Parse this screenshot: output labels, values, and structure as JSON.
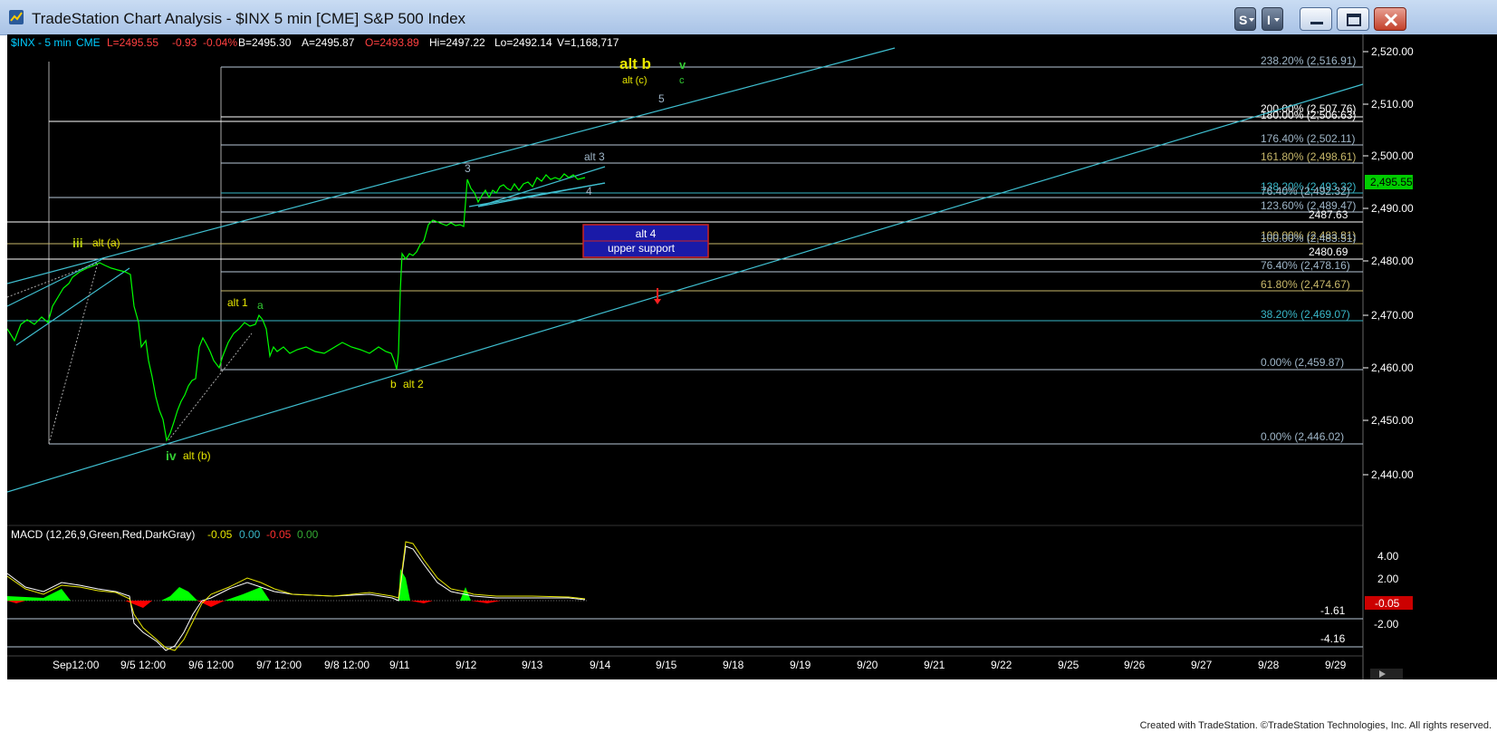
{
  "window": {
    "title": "TradeStation Chart Analysis - $INX 5 min [CME] S&P 500 Index",
    "buttons": {
      "menu1": "S",
      "menu2": "I"
    }
  },
  "header": {
    "symbol": "$INX - 5 min",
    "exchange": "CME",
    "last": "L=2495.55",
    "change": "-0.93",
    "change_pct": "-0.04%",
    "bid": "B=2495.30",
    "ask": "A=2495.87",
    "open": "O=2493.89",
    "high": "Hi=2497.22",
    "low": "Lo=2492.14",
    "volume": "V=1,168,717"
  },
  "price_axis": {
    "ticks": [
      "2,520.00",
      "2,510.00",
      "2,500.00",
      "2,490.00",
      "2,480.00",
      "2,470.00",
      "2,460.00",
      "2,450.00",
      "2,440.00"
    ],
    "current": "2,495.55",
    "current_color": "#00cc00"
  },
  "fib_labels": [
    {
      "text": "238.20% (2,516.91)",
      "color": "#9fb6c8"
    },
    {
      "text": "200.00% (2,507.76)",
      "color": "#ffffff"
    },
    {
      "text": "180.00% (2,506.63)",
      "color": "#ffffff"
    },
    {
      "text": "176.40% (2,502.11)",
      "color": "#9fb6c8"
    },
    {
      "text": "161.80% (2,498.61)",
      "color": "#c8b86a"
    },
    {
      "text": "138.20% (2,493.32)",
      "color": "#39b7c8"
    },
    {
      "text": "76.40% (2,492.32)",
      "color": "#9fb6c8"
    },
    {
      "text": "123.60% (2,489.47)",
      "color": "#9fb6c8"
    },
    {
      "text": "2487.63",
      "color": "#ffffff"
    },
    {
      "text": "100.00% (2,483.81)",
      "color": "#c8b86a"
    },
    {
      "text": "100.00% (2,483.51)",
      "color": "#9fb6c8"
    },
    {
      "text": "2480.69",
      "color": "#ffffff"
    },
    {
      "text": "76.40% (2,478.16)",
      "color": "#9fb6c8"
    },
    {
      "text": "61.80% (2,474.67)",
      "color": "#c8b86a"
    },
    {
      "text": "38.20% (2,469.07)",
      "color": "#39b7c8"
    },
    {
      "text": "0.00% (2,459.87)",
      "color": "#9fb6c8"
    },
    {
      "text": "0.00% (2,446.02)",
      "color": "#9fb6c8"
    }
  ],
  "wave_labels": {
    "alt_b": "alt b",
    "v": "v",
    "alt_c": "alt (c)",
    "c": "c",
    "five": "5",
    "alt3": "alt 3",
    "three": "3",
    "four": "4",
    "iii": "iii",
    "alt_a": "alt (a)",
    "alt1": "alt 1",
    "a": "a",
    "b": "b",
    "alt2": "alt 2",
    "iv": "iv",
    "alt_b_paren": "alt (b)"
  },
  "support_box": {
    "line1": "alt 4",
    "line2": "upper support"
  },
  "macd": {
    "title": "MACD (12,26,9,Green,Red,DarkGray)",
    "v1": "-0.05",
    "v2": "0.00",
    "v3": "-0.05",
    "v4": "0.00",
    "axis_ticks": [
      "4.00",
      "2.00",
      "-2.00"
    ],
    "level1": "-1.61",
    "level2": "-4.16",
    "current": "-0.05"
  },
  "time_axis": [
    "Sep12:00",
    "9/5 12:00",
    "9/6 12:00",
    "9/7 12:00",
    "9/8 12:00",
    "9/11",
    "9/12",
    "9/13",
    "9/14",
    "9/15",
    "9/18",
    "9/19",
    "9/20",
    "9/21",
    "9/22",
    "9/25",
    "9/26",
    "9/27",
    "9/28",
    "9/29"
  ],
  "footer": {
    "credit": "Created with TradeStation. ©TradeStation Technologies, Inc. All rights reserved."
  },
  "colors": {
    "background": "#000000",
    "price_line": "#00ff00",
    "trendline": "#3fbfd0",
    "yellow_label": "#e6e600",
    "green_label": "#33cc33",
    "macd_pos": "#00ff00",
    "macd_neg": "#ff0000",
    "support_box": "#1a1aa8"
  }
}
